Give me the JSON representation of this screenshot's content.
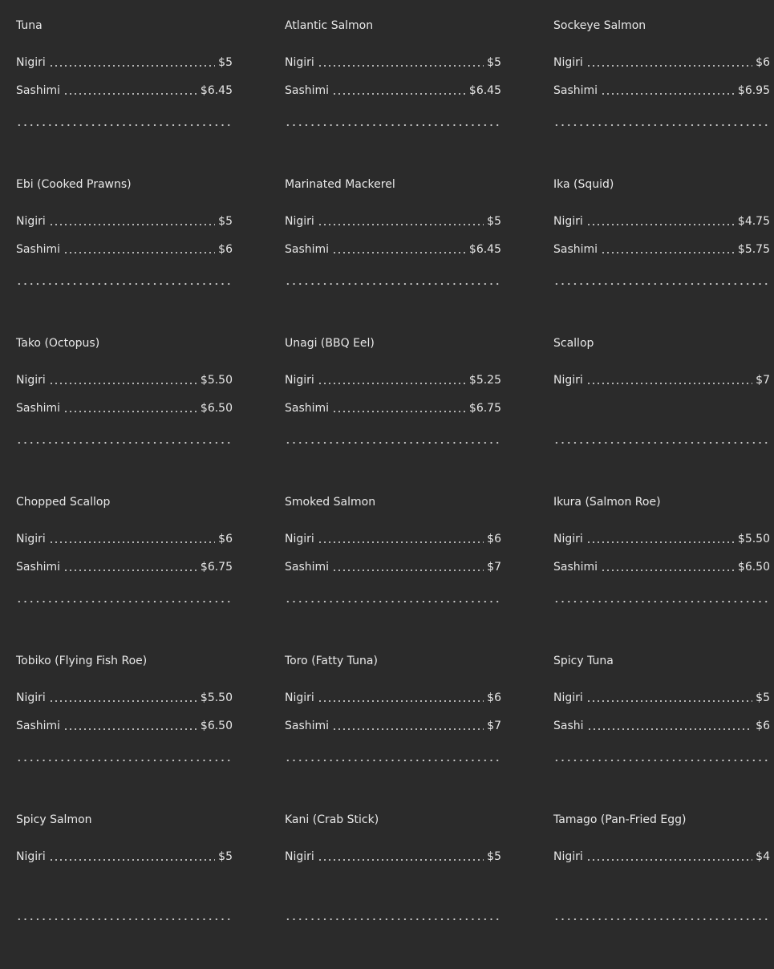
{
  "menu": {
    "items": [
      {
        "name": "Tuna",
        "prices": [
          {
            "label": "Nigiri",
            "price": "$5"
          },
          {
            "label": "Sashimi",
            "price": "$6.45"
          }
        ]
      },
      {
        "name": "Atlantic Salmon",
        "prices": [
          {
            "label": "Nigiri",
            "price": "$5"
          },
          {
            "label": "Sashimi",
            "price": "$6.45"
          }
        ]
      },
      {
        "name": "Sockeye Salmon",
        "prices": [
          {
            "label": "Nigiri",
            "price": "$6"
          },
          {
            "label": "Sashimi",
            "price": "$6.95"
          }
        ]
      },
      {
        "name": "Ebi (Cooked Prawns)",
        "prices": [
          {
            "label": "Nigiri",
            "price": "$5"
          },
          {
            "label": "Sashimi",
            "price": "$6"
          }
        ]
      },
      {
        "name": "Marinated Mackerel",
        "prices": [
          {
            "label": "Nigiri",
            "price": "$5"
          },
          {
            "label": "Sashimi",
            "price": "$6.45"
          }
        ]
      },
      {
        "name": "Ika (Squid)",
        "prices": [
          {
            "label": "Nigiri",
            "price": "$4.75"
          },
          {
            "label": "Sashimi",
            "price": "$5.75"
          }
        ]
      },
      {
        "name": "Tako (Octopus)",
        "prices": [
          {
            "label": "Nigiri",
            "price": "$5.50"
          },
          {
            "label": "Sashimi",
            "price": "$6.50"
          }
        ]
      },
      {
        "name": "Unagi (BBQ Eel)",
        "prices": [
          {
            "label": "Nigiri",
            "price": "$5.25"
          },
          {
            "label": "Sashimi",
            "price": "$6.75"
          }
        ]
      },
      {
        "name": "Scallop",
        "prices": [
          {
            "label": "Nigiri",
            "price": "$7"
          }
        ]
      },
      {
        "name": "Chopped Scallop",
        "prices": [
          {
            "label": "Nigiri",
            "price": "$6"
          },
          {
            "label": "Sashimi",
            "price": "$6.75"
          }
        ]
      },
      {
        "name": "Smoked Salmon",
        "prices": [
          {
            "label": "Nigiri",
            "price": "$6"
          },
          {
            "label": "Sashimi",
            "price": "$7"
          }
        ]
      },
      {
        "name": "Ikura (Salmon Roe)",
        "prices": [
          {
            "label": "Nigiri",
            "price": "$5.50"
          },
          {
            "label": "Sashimi",
            "price": "$6.50"
          }
        ]
      },
      {
        "name": "Tobiko (Flying Fish Roe)",
        "prices": [
          {
            "label": "Nigiri",
            "price": "$5.50"
          },
          {
            "label": "Sashimi",
            "price": "$6.50"
          }
        ]
      },
      {
        "name": "Toro (Fatty Tuna)",
        "prices": [
          {
            "label": "Nigiri",
            "price": "$6"
          },
          {
            "label": "Sashimi",
            "price": "$7"
          }
        ]
      },
      {
        "name": "Spicy Tuna",
        "prices": [
          {
            "label": "Nigiri",
            "price": "$5"
          },
          {
            "label": "Sashi",
            "price": "$6"
          }
        ]
      },
      {
        "name": "Spicy Salmon",
        "prices": [
          {
            "label": "Nigiri",
            "price": "$5"
          }
        ]
      },
      {
        "name": "Kani (Crab Stick)",
        "prices": [
          {
            "label": "Nigiri",
            "price": "$5"
          }
        ]
      },
      {
        "name": "Tamago (Pan-Fried Egg)",
        "prices": [
          {
            "label": "Nigiri",
            "price": "$4"
          }
        ]
      }
    ]
  }
}
